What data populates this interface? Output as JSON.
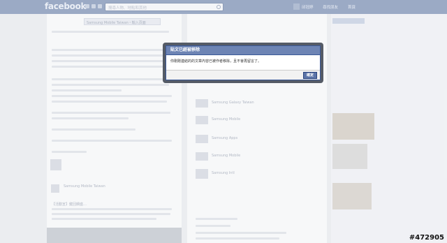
{
  "topbar": {
    "logo": "facebook",
    "search_placeholder": "搜尋人物、地點和其他",
    "user_name": "邱冠婷",
    "links": [
      "尋找朋友",
      "首頁"
    ]
  },
  "page_header": {
    "label": "Samsung Mobile Taiwan・輸入頁面"
  },
  "background_posts": {
    "left_author": "Samsung Mobile Taiwan",
    "left_heading": "【活動宣】鍵回饋盛…",
    "mid_items": [
      "Samsung Galaxy Taiwan",
      "Samsung Mobile",
      "Samsung Apps",
      "Samsung Mobile",
      "Samsung Intl"
    ]
  },
  "dialog": {
    "title": "貼文已經被移除",
    "body": "你剛剛連結的的文章內容已被作者移除，且不會再留言了。",
    "confirm_label": "確定"
  },
  "watermark": "#472905"
}
